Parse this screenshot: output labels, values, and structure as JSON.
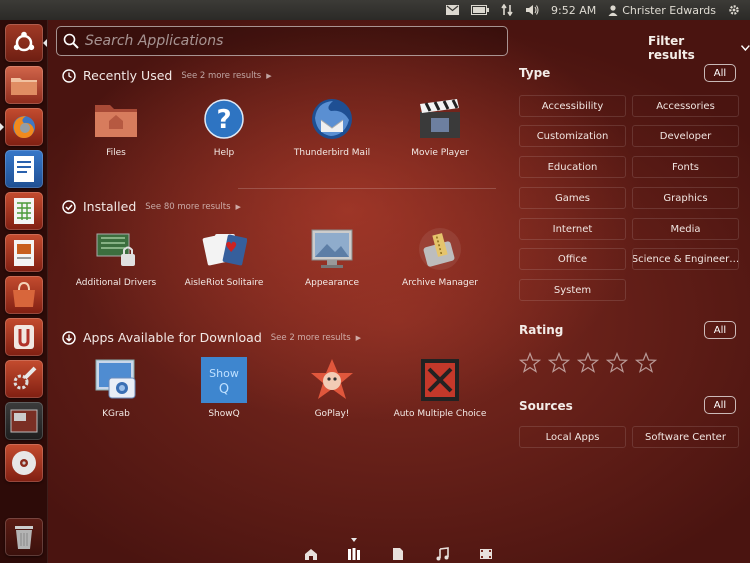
{
  "top_panel": {
    "time": "9:52 AM",
    "user_name": "Christer Edwards",
    "indicators": [
      "mail-icon",
      "battery-icon",
      "network-icon",
      "volume-icon",
      "gear-icon"
    ]
  },
  "search": {
    "placeholder": "Search Applications",
    "value": ""
  },
  "filter_toggle_label": "Filter results",
  "sections": {
    "recent": {
      "title": "Recently Used",
      "see_more": "See 2 more results",
      "apps": [
        {
          "label": "Files",
          "icon": "files-icon"
        },
        {
          "label": "Help",
          "icon": "help-icon"
        },
        {
          "label": "Thunderbird Mail",
          "icon": "thunderbird-icon"
        },
        {
          "label": "Movie Player",
          "icon": "movie-player-icon"
        }
      ]
    },
    "installed": {
      "title": "Installed",
      "see_more": "See 80 more results",
      "apps": [
        {
          "label": "Additional Drivers",
          "icon": "additional-drivers-icon"
        },
        {
          "label": "AisleRiot Solitaire",
          "icon": "aisleriot-icon"
        },
        {
          "label": "Appearance",
          "icon": "appearance-icon"
        },
        {
          "label": "Archive Manager",
          "icon": "archive-manager-icon"
        }
      ]
    },
    "download": {
      "title": "Apps Available for Download",
      "see_more": "See 2 more results",
      "apps": [
        {
          "label": "KGrab",
          "icon": "kgrab-icon"
        },
        {
          "label": "ShowQ",
          "icon": "showq-icon"
        },
        {
          "label": "GoPlay!",
          "icon": "goplay-icon"
        },
        {
          "label": "Auto Multiple Choice",
          "icon": "auto-multiple-choice-icon"
        }
      ]
    }
  },
  "filters": {
    "all_label": "All",
    "type": {
      "title": "Type",
      "options": [
        "Accessibility",
        "Accessories",
        "Customization",
        "Developer",
        "Education",
        "Fonts",
        "Games",
        "Graphics",
        "Internet",
        "Media",
        "Office",
        "Science & Engineer…",
        "System"
      ]
    },
    "rating": {
      "title": "Rating",
      "stars": 5
    },
    "sources": {
      "title": "Sources",
      "options": [
        "Local Apps",
        "Software Center"
      ]
    }
  },
  "launcher": {
    "items": [
      "ubuntu-dash-icon",
      "files-icon",
      "firefox-icon",
      "writer-icon",
      "calc-icon",
      "impress-icon",
      "software-center-icon",
      "ubuntu-one-icon",
      "system-settings-icon",
      "workspace-switcher-icon",
      "dvd-icon",
      "trash-icon"
    ]
  },
  "lenses": [
    "home-lens-icon",
    "applications-lens-icon",
    "files-lens-icon",
    "music-lens-icon",
    "video-lens-icon"
  ]
}
